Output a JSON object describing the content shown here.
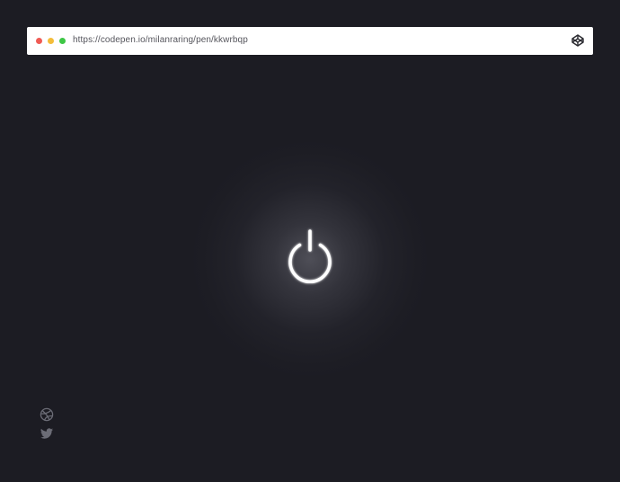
{
  "browser": {
    "url": "https://codepen.io/milanraring/pen/kkwrbqp",
    "dot_colors": {
      "close": "#f05b54",
      "minimize": "#f4bd3a",
      "maximize": "#3ec746"
    },
    "right_icon": "codepen-icon"
  },
  "power_button": {
    "icon": "power-icon",
    "state": "on",
    "glow_color": "#ffffff"
  },
  "social_links": [
    {
      "icon": "dribbble-icon"
    },
    {
      "icon": "twitter-icon"
    }
  ],
  "colors": {
    "background": "#1c1c23",
    "urlbar": "#ffffff",
    "icon_muted": "#6b6c76"
  }
}
